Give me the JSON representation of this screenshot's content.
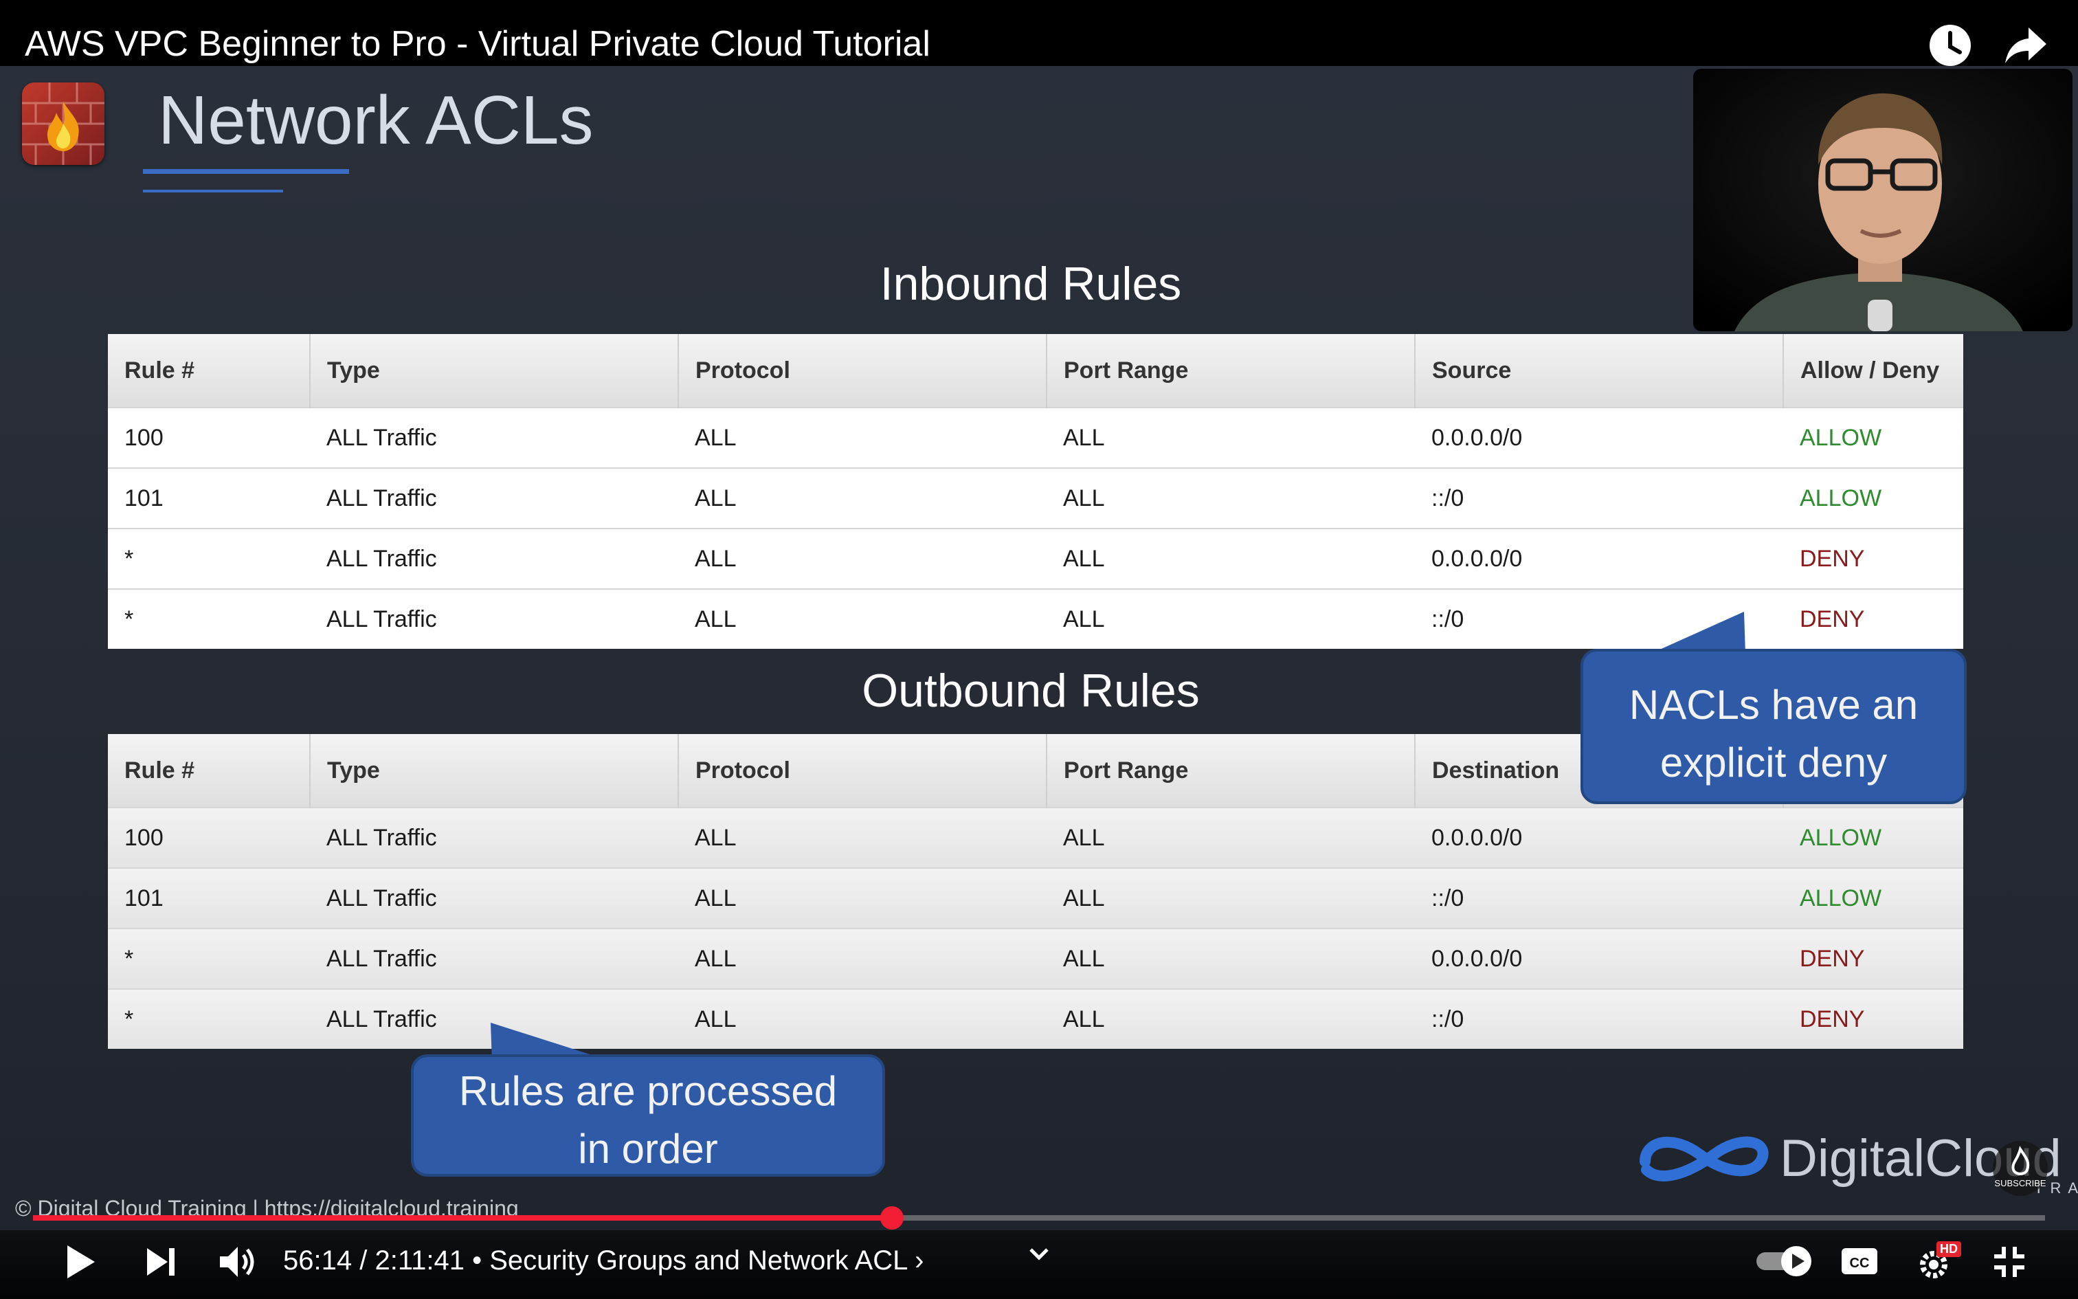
{
  "video": {
    "title": "AWS VPC Beginner to Pro - Virtual Private Cloud Tutorial",
    "current_time": "56:14",
    "duration": "2:11:41",
    "separator": "/",
    "chapter": "Security Groups and Network ACL",
    "chapter_prefix": "•",
    "chapter_suffix": "›",
    "progress": 0.427,
    "buffered": 0.43
  },
  "slide": {
    "title": "Network ACLs",
    "inbound": {
      "title": "Inbound Rules",
      "headers": [
        "Rule #",
        "Type",
        "Protocol",
        "Port Range",
        "Source",
        "Allow / Deny"
      ],
      "rows": [
        [
          "100",
          "ALL Traffic",
          "ALL",
          "ALL",
          "0.0.0.0/0",
          "ALLOW"
        ],
        [
          "101",
          "ALL Traffic",
          "ALL",
          "ALL",
          "::/0",
          "ALLOW"
        ],
        [
          "*",
          "ALL Traffic",
          "ALL",
          "ALL",
          "0.0.0.0/0",
          "DENY"
        ],
        [
          "*",
          "ALL Traffic",
          "ALL",
          "ALL",
          "::/0",
          "DENY"
        ]
      ]
    },
    "outbound": {
      "title": "Outbound Rules",
      "headers": [
        "Rule #",
        "Type",
        "Protocol",
        "Port Range",
        "Destination",
        ""
      ],
      "rows": [
        [
          "100",
          "ALL Traffic",
          "ALL",
          "ALL",
          "0.0.0.0/0",
          "ALLOW"
        ],
        [
          "101",
          "ALL Traffic",
          "ALL",
          "ALL",
          "::/0",
          "ALLOW"
        ],
        [
          "*",
          "ALL Traffic",
          "ALL",
          "ALL",
          "0.0.0.0/0",
          "DENY"
        ],
        [
          "*",
          "ALL Traffic",
          "ALL",
          "ALL",
          "::/0",
          "DENY"
        ]
      ]
    },
    "callout_deny": [
      "NACLs have an",
      "explicit deny"
    ],
    "callout_order": [
      "Rules are processed",
      "in order"
    ],
    "brand": "DigitalCloud",
    "brand_sub": "TRAI",
    "copyright": "© Digital Cloud Training  |  https://digitalcloud.training"
  },
  "overlay": {
    "subscribe": "SUBSCRIBE",
    "hd_badge": "HD"
  },
  "colors": {
    "allow": "#2e8b2e",
    "deny": "#8b1a1a",
    "progress": "#f01d33",
    "callout": "#2f5aa8",
    "accent_line": "#3a6cc6"
  },
  "icons": [
    "watch-later-icon",
    "share-icon",
    "play-icon",
    "next-icon",
    "volume-icon",
    "chevron-down-icon",
    "autoplay-toggle-icon",
    "captions-icon",
    "settings-icon",
    "exit-fullscreen-icon",
    "firewall-logo-icon"
  ]
}
